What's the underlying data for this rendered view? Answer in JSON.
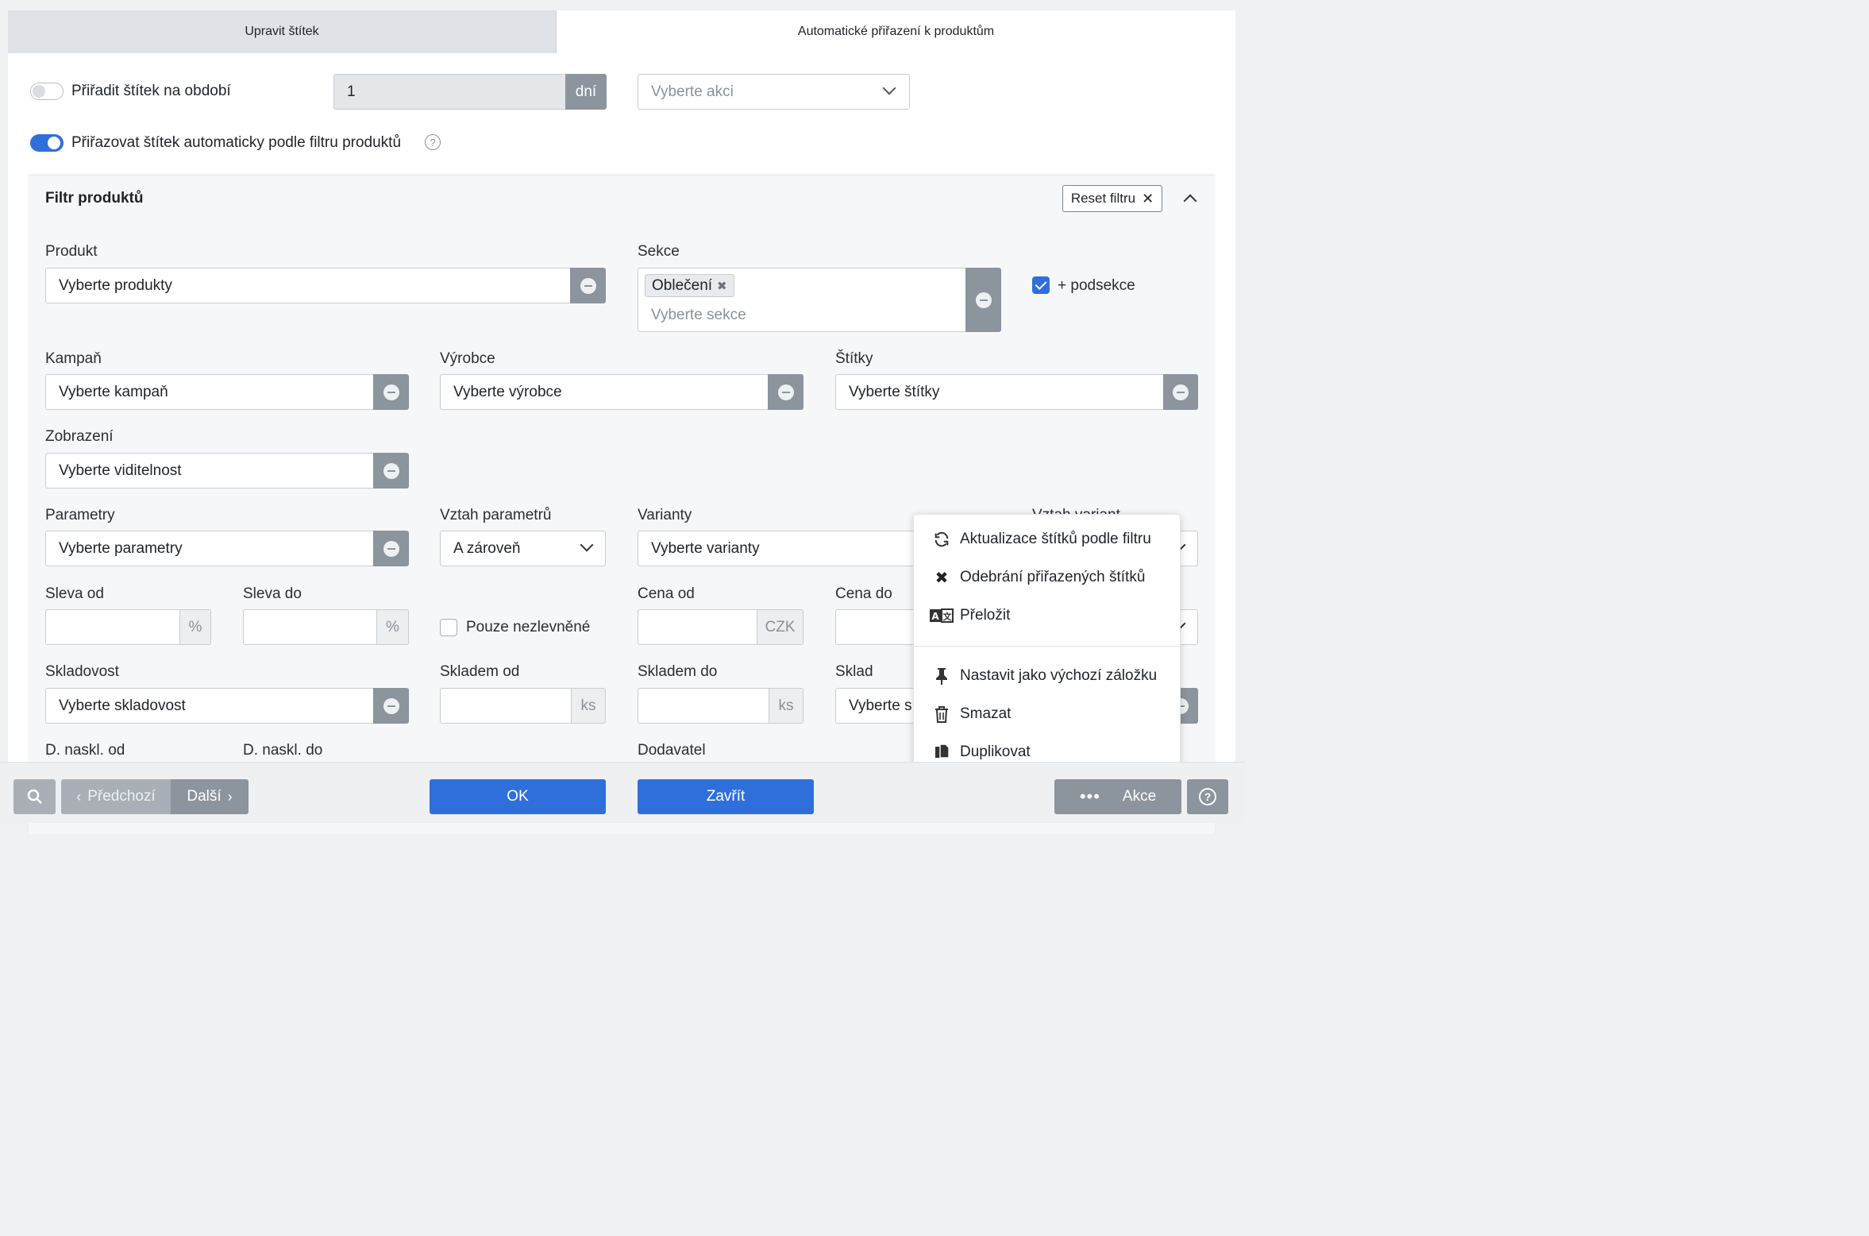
{
  "tabs": {
    "edit": "Upravit štítek",
    "auto": "Automatické přiřazení k produktům"
  },
  "period": {
    "label": "Přiřadit štítek na období",
    "enabled": false,
    "days_value": "1",
    "days_unit": "dní",
    "action_placeholder": "Vyberte akci"
  },
  "auto_assign": {
    "label": "Přiřazovat štítek automaticky podle filtru produktů",
    "enabled": true
  },
  "filter": {
    "title": "Filtr produktů",
    "reset_label": "Reset filtru",
    "product": {
      "label": "Produkt",
      "placeholder": "Vyberte produkty"
    },
    "section": {
      "label": "Sekce",
      "tag": "Oblečení",
      "placeholder": "Vyberte sekce",
      "subsections_label": "+ podsekce",
      "subsections_checked": true
    },
    "campaign": {
      "label": "Kampaň",
      "placeholder": "Vyberte kampaň"
    },
    "manufacturer": {
      "label": "Výrobce",
      "placeholder": "Vyberte výrobce"
    },
    "tags": {
      "label": "Štítky",
      "placeholder": "Vyberte štítky"
    },
    "visibility": {
      "label": "Zobrazení",
      "placeholder": "Vyberte viditelnost"
    },
    "parameters": {
      "label": "Parametry",
      "placeholder": "Vyberte parametry"
    },
    "param_relation": {
      "label": "Vztah parametrů",
      "value": "A zároveň"
    },
    "variants": {
      "label": "Varianty",
      "placeholder": "Vyberte varianty"
    },
    "variant_relation": {
      "label": "Vztah variant"
    },
    "discount_from": {
      "label": "Sleva od",
      "unit": "%"
    },
    "discount_to": {
      "label": "Sleva do",
      "unit": "%"
    },
    "only_not_discounted": {
      "label": "Pouze nezlevněné",
      "checked": false
    },
    "price_from": {
      "label": "Cena od",
      "unit": "CZK"
    },
    "price_to": {
      "label": "Cena do"
    },
    "stock_status": {
      "label": "Skladovost",
      "placeholder": "Vyberte skladovost"
    },
    "stock_from": {
      "label": "Skladem od",
      "unit": "ks"
    },
    "stock_to": {
      "label": "Skladem do",
      "unit": "ks"
    },
    "warehouse": {
      "label": "Sklad",
      "placeholder": "Vyberte s"
    },
    "restock_from": {
      "label": "D. naskl. od"
    },
    "restock_to": {
      "label": "D. naskl. do"
    },
    "supplier": {
      "label": "Dodavatel"
    }
  },
  "context_menu": {
    "items": [
      {
        "label": "Aktualizace štítků podle filtru",
        "icon": "refresh-icon"
      },
      {
        "label": "Odebrání přiřazených štítků",
        "icon": "close-icon"
      },
      {
        "label": "Přeložit",
        "icon": "translate-icon"
      },
      {
        "label": "Nastavit jako výchozí záložku",
        "icon": "pin-icon"
      },
      {
        "label": "Smazat",
        "icon": "trash-icon"
      },
      {
        "label": "Duplikovat",
        "icon": "duplicate-icon"
      }
    ]
  },
  "footer": {
    "prev_label": "Předchozí",
    "next_label": "Další",
    "ok_label": "OK",
    "close_label": "Zavřít",
    "actions_label": "Akce"
  },
  "colors": {
    "accent": "#2f6fdc",
    "addon_gray": "#8c949e"
  }
}
